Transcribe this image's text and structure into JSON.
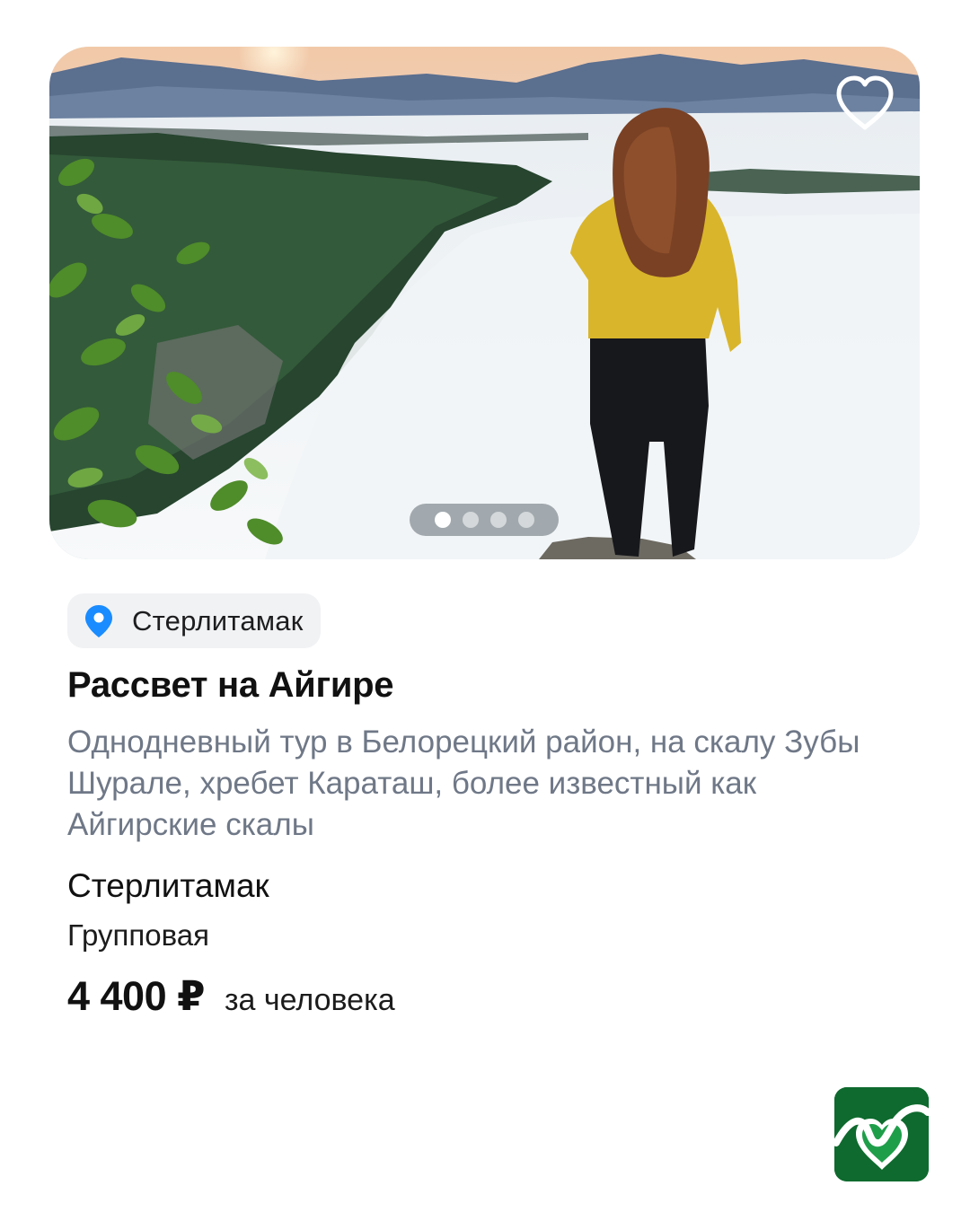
{
  "card": {
    "photo": {
      "alt": "Рассвет на Айгире",
      "pager": {
        "total": 4,
        "active_index": 0
      },
      "favorite_icon": "heart-outline-icon"
    },
    "location_chip": {
      "icon": "location-pin-icon",
      "label": "Стерлитамак",
      "icon_color": "#1a8cff"
    },
    "title": "Рассвет на Айгире",
    "description": "Однодневный тур в Белорецкий район, на скалу Зубы Шурале, хребет Караташ, более известный как Айгирские скалы",
    "city": "Стерлитамак",
    "tour_type": "Групповая",
    "price": "4 400 ₽",
    "price_unit": "за человека"
  },
  "colors": {
    "description_text": "#6f7887",
    "logo_background": "#0e6a2e"
  },
  "app_logo": {
    "icon": "app-logo-icon"
  }
}
